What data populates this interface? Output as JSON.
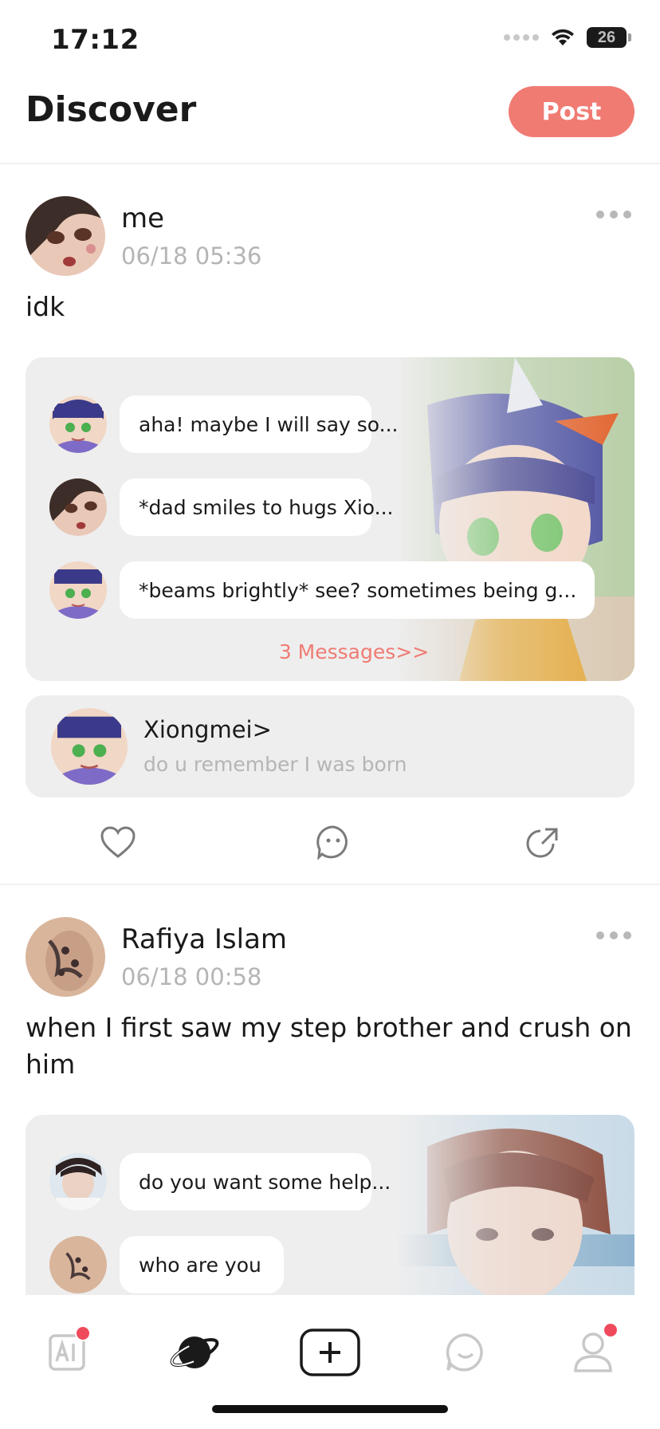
{
  "status_bar": {
    "time": "17:12",
    "battery": "26"
  },
  "header": {
    "title": "Discover",
    "post_label": "Post"
  },
  "posts": [
    {
      "user_name": "me",
      "time": "06/18 05:36",
      "text": "idk",
      "messages": [
        {
          "text": "aha! maybe I will say so..."
        },
        {
          "text": "*dad smiles to hugs Xio..."
        },
        {
          "text": "*beams brightly* see? sometimes being g..."
        }
      ],
      "messages_link": "3  Messages>>",
      "character": {
        "name": "Xiongmei>",
        "caption": "do u remember I was born"
      }
    },
    {
      "user_name": "Rafiya Islam",
      "time": "06/18 00:58",
      "text": "when I first saw my step brother and crush on him",
      "messages": [
        {
          "text": "do you want some help..."
        },
        {
          "text": "who are you"
        }
      ]
    }
  ],
  "icons": {
    "more": "more-dots-icon",
    "like": "heart-icon",
    "comment": "comment-bubble-icon",
    "share": "share-icon",
    "tabs": [
      "ai-icon",
      "planet-icon",
      "add-icon",
      "chat-icon",
      "profile-icon"
    ]
  },
  "colors": {
    "accent": "#f07b73",
    "badge": "#ef4a5c",
    "card_bg": "#eeeeee",
    "secondary_text": "#b5b5b5"
  }
}
